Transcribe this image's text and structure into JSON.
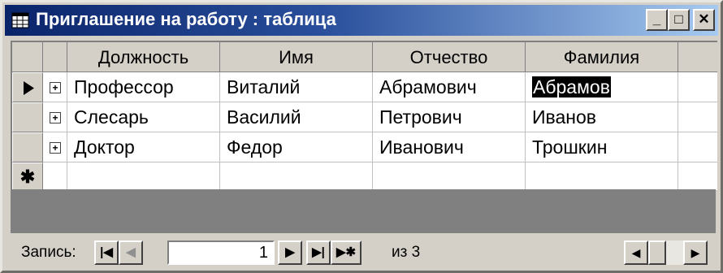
{
  "window": {
    "title": "Приглашение на работу : таблица",
    "controls": {
      "minimize": "_",
      "maximize": "□",
      "close": "✕"
    }
  },
  "table": {
    "columns": [
      "Должность",
      "Имя",
      "Отчество",
      "Фамилия"
    ],
    "rows": [
      {
        "current": true,
        "cells": [
          "Профессор",
          "Виталий",
          "Абрамович",
          "Абрамов"
        ]
      },
      {
        "current": false,
        "cells": [
          "Слесарь",
          "Василий",
          "Петрович",
          "Иванов"
        ]
      },
      {
        "current": false,
        "cells": [
          "Доктор",
          "Федор",
          "Иванович",
          "Трошкин"
        ]
      }
    ],
    "new_row_marker": "✱",
    "expand_symbol": "+",
    "current_row_marker": "▶"
  },
  "navigation": {
    "label": "Запись:",
    "current_record": "1",
    "total_text": "из 3",
    "buttons": {
      "first": "|◀",
      "prev": "◀",
      "next": "▶",
      "last": "▶|",
      "new": "▶✱"
    }
  },
  "scrollbar": {
    "left": "◀",
    "right": "▶"
  }
}
